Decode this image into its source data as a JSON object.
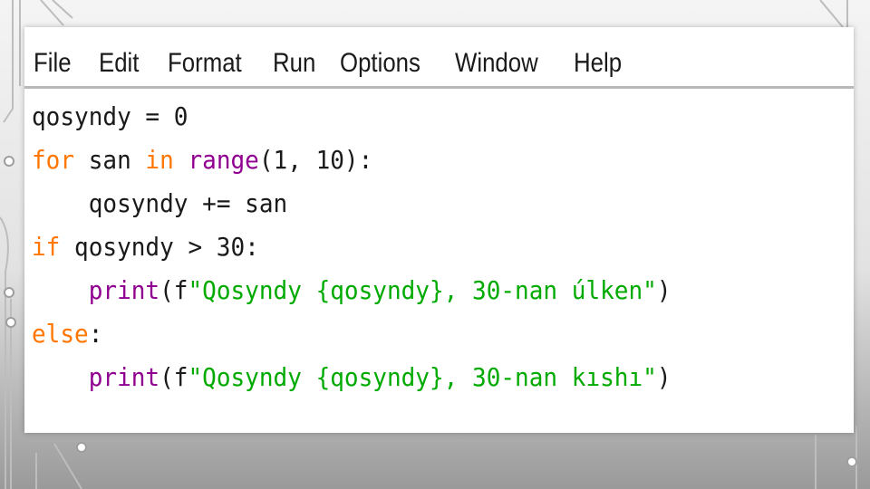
{
  "menu": {
    "file": "File",
    "edit": "Edit",
    "format": "Format",
    "run": "Run",
    "options": "Options",
    "window": "Window",
    "help": "Help"
  },
  "code": {
    "line1": {
      "text": "qosyndy = 0"
    },
    "line2": {
      "kw1": "for",
      "mid1": " san ",
      "kw2": "in",
      "sp": " ",
      "bi": "range",
      "rest": "(1, 10):"
    },
    "line3": {
      "indent": "    ",
      "text": "qosyndy += san"
    },
    "line4": {
      "kw": "if",
      "rest": " qosyndy > 30:"
    },
    "line5": {
      "indent": "    ",
      "bi": "print",
      "open": "(f",
      "str": "\"Qosyndy {qosyndy}, 30-nan úlken\"",
      "close": ")"
    },
    "line6": {
      "kw": "else",
      "rest": ":"
    },
    "line7": {
      "indent": "    ",
      "bi": "print",
      "open": "(f",
      "str": "\"Qosyndy {qosyndy}, 30-nan kıshı\"",
      "close": ")"
    }
  },
  "colors": {
    "keyword": "#ff7700",
    "builtin": "#900090",
    "string": "#00aa00",
    "text": "#1a1a1a"
  }
}
